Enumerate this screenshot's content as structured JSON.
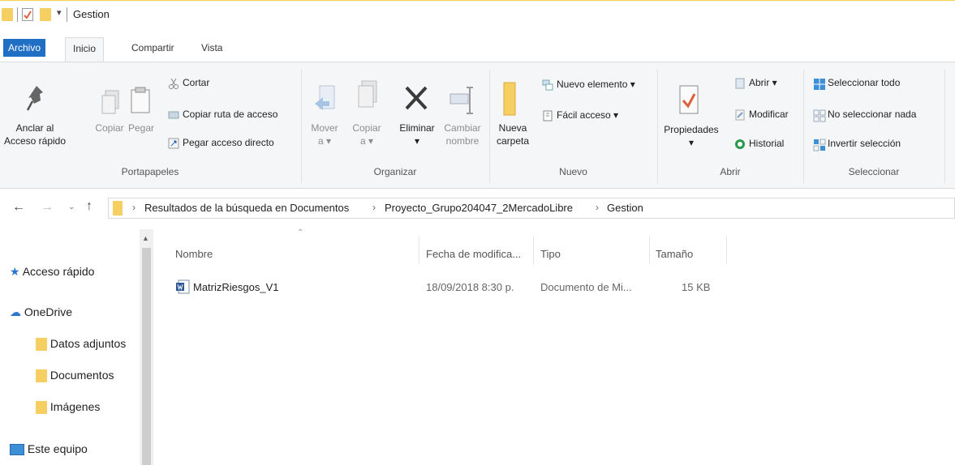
{
  "window": {
    "title": "Gestion"
  },
  "tabs": {
    "file": "Archivo",
    "home": "Inicio",
    "share": "Compartir",
    "view": "Vista"
  },
  "ribbon": {
    "clipboard": {
      "label": "Portapapeles",
      "pin_line1": "Anclar al",
      "pin_line2": "Acceso rápido",
      "copy": "Copiar",
      "paste": "Pegar",
      "cut": "Cortar",
      "copy_path": "Copiar ruta de acceso",
      "paste_shortcut": "Pegar acceso directo"
    },
    "organize": {
      "label": "Organizar",
      "move_line1": "Mover",
      "move_line2": "a",
      "copy_line1": "Copiar",
      "copy_line2": "a",
      "delete": "Eliminar",
      "rename_line1": "Cambiar",
      "rename_line2": "nombre"
    },
    "new": {
      "label": "Nuevo",
      "folder_line1": "Nueva",
      "folder_line2": "carpeta",
      "new_item": "Nuevo elemento",
      "easy_access": "Fácil acceso"
    },
    "open": {
      "label": "Abrir",
      "properties": "Propiedades",
      "open": "Abrir",
      "edit": "Modificar",
      "history": "Historial"
    },
    "select": {
      "label": "Seleccionar",
      "select_all": "Seleccionar todo",
      "select_none": "No seleccionar nada",
      "invert": "Invertir selección"
    }
  },
  "address": {
    "crumbs": [
      "Resultados de la búsqueda en Documentos",
      "Proyecto_Grupo204047_2MercadoLibre",
      "Gestion"
    ]
  },
  "nav": {
    "quick_access": "Acceso rápido",
    "onedrive": "OneDrive",
    "folders": [
      "Datos adjuntos",
      "Documentos",
      "Imágenes"
    ],
    "this_pc": "Este equipo"
  },
  "files": {
    "columns": [
      "Nombre",
      "Fecha de modifica...",
      "Tipo",
      "Tamaño"
    ],
    "rows": [
      {
        "name": "MatrizRiesgos_V1",
        "date": "18/09/2018 8:30 p.",
        "type": "Documento de Mi...",
        "size": "15 KB"
      }
    ]
  },
  "colors": {
    "accent": "#1f6fc4",
    "folder": "#f6cf62",
    "title_border": "#f2d34a"
  }
}
